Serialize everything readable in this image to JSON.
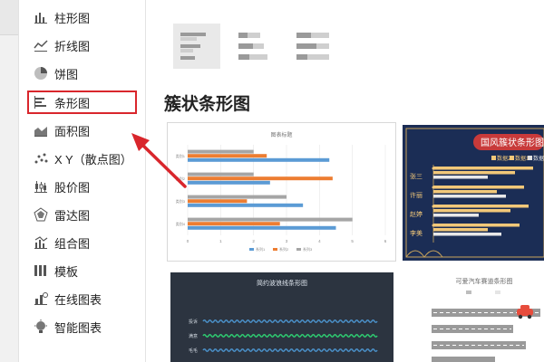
{
  "sidebar": {
    "items": [
      {
        "label": "柱形图",
        "icon": "column-chart-icon"
      },
      {
        "label": "折线图",
        "icon": "line-chart-icon"
      },
      {
        "label": "饼图",
        "icon": "pie-chart-icon"
      },
      {
        "label": "条形图",
        "icon": "bar-chart-icon",
        "selected": true
      },
      {
        "label": "面积图",
        "icon": "area-chart-icon"
      },
      {
        "label": "X Y（散点图）",
        "icon": "scatter-chart-icon"
      },
      {
        "label": "股价图",
        "icon": "stock-chart-icon"
      },
      {
        "label": "雷达图",
        "icon": "radar-chart-icon"
      },
      {
        "label": "组合图",
        "icon": "combo-chart-icon"
      },
      {
        "label": "模板",
        "icon": "template-icon"
      },
      {
        "label": "在线图表",
        "icon": "online-chart-icon"
      },
      {
        "label": "智能图表",
        "icon": "smart-chart-icon"
      }
    ]
  },
  "main": {
    "section_title": "簇状条形图",
    "cards": {
      "card1": {
        "title": "图表标题",
        "chart_data": {
          "type": "bar",
          "orientation": "horizontal",
          "title": "图表标题",
          "categories": [
            "类别1",
            "类别2",
            "类别3",
            "类别4"
          ],
          "series": [
            {
              "name": "系列1",
              "values": [
                4.3,
                2.5,
                3.5,
                4.5
              ]
            },
            {
              "name": "系列2",
              "values": [
                2.4,
                4.4,
                1.8,
                2.8
              ]
            },
            {
              "name": "系列3",
              "values": [
                2.0,
                2.0,
                3.0,
                5.0
              ]
            }
          ],
          "xlim": [
            0,
            6
          ],
          "xticks": [
            "0",
            "1",
            "2",
            "3",
            "4",
            "5",
            "6"
          ],
          "legend": "bottom",
          "colors": [
            "#5b9bd5",
            "#ed7d31",
            "#a5a5a5"
          ]
        }
      },
      "card2": {
        "title": "国风簇状条形图",
        "categories": [
          "张三",
          "许丽",
          "赵婷",
          "李美"
        ],
        "legend": [
          "数据2",
          "数据1",
          "数据3"
        ]
      },
      "card3": {
        "title": "简约波浪线条形图",
        "labels": [
          "投诉",
          "满意",
          "毛毛"
        ]
      },
      "card4": {
        "title": "可爱汽车赛道条形图"
      }
    }
  },
  "colors": {
    "highlight": "#d9262c",
    "arrow": "#d9262c",
    "guofeng_bg": "#1b2d55",
    "guofeng_bar": "#f2c879",
    "guofeng_title": "#c83a3a"
  }
}
